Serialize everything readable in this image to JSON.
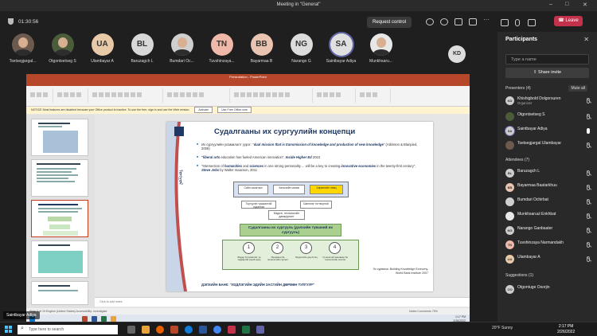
{
  "window": {
    "title": "Meeting in \"General\""
  },
  "header": {
    "timer": "01:30:56",
    "request_control": "Request control",
    "leave": "Leave"
  },
  "strip": {
    "participants": [
      {
        "initials": "",
        "name": "Tsetsegjargal...",
        "photo": true
      },
      {
        "initials": "",
        "name": "Otgontsetseg S",
        "photo": true
      },
      {
        "initials": "UA",
        "name": "Ulambayar A",
        "color": "#e8c9a8"
      },
      {
        "initials": "BL",
        "name": "Baruzagch L",
        "color": "#d8d8d8"
      },
      {
        "initials": "",
        "name": "Bumdari Oc...",
        "photo": true
      },
      {
        "initials": "TN",
        "name": "Tuvshinzaya...",
        "color": "#f0b8a8"
      },
      {
        "initials": "BB",
        "name": "Bayarmaa B",
        "color": "#e9c4b0"
      },
      {
        "initials": "NG",
        "name": "Narango G",
        "color": "#dcdcdc"
      },
      {
        "initials": "SA",
        "name": "Saintbayar Adiya",
        "color": "#e0e0e0"
      },
      {
        "initials": "",
        "name": "Munkhsaru...",
        "photo": true
      }
    ],
    "extra": "KD"
  },
  "ppt": {
    "title": "Presentation - PowerPoint",
    "tabs": [
      "File",
      "Home",
      "Insert",
      "Design",
      "Transitions",
      "Animations",
      "Slide Show",
      "Review",
      "View",
      "Help"
    ],
    "notice": "NOTICE  Most features are disabled because your Office product is inactive. To use the free, sign in and use the Web version.",
    "notice_btn1": "Activate",
    "notice_btn2": "Use Free Office.com",
    "notes_placeholder": "Click to add notes",
    "status_left": "Slide 3 of 19     English (United States)     Accessibility: Investigate",
    "status_right": "Notes     Comments     75%",
    "inner_time": "1:17 PM",
    "inner_date": "2/26/2022",
    "thumb_numbers": [
      "1",
      "2",
      "3",
      "4",
      "5"
    ]
  },
  "slide": {
    "title": "Судалгааны их сургуулийн концепци",
    "b1_a": "Их сургуулийн уламжлалт үүрэг: \"",
    "b1_em": "dual mission that is transmission of knowledge and production of new knowledge",
    "b1_b": "\" (Atkinson & Blanpied, 2008)",
    "b2_em": "\"liberal arts",
    "b2_b": " education has fueled American innovation\", ",
    "b2_c": "Inside Higher Ed",
    "b2_d": " 2010",
    "b3_a": "\"Intersection of ",
    "b3_em1": "humanities",
    "b3_b": " and ",
    "b3_em2": "sciences",
    "b3_c": " in one strong personality ... will be a key to creating ",
    "b3_em3": "innovative economies",
    "b3_d": " in the twenty-first century\", ",
    "b3_e": "Steve Jobs",
    "b3_f": " by Walter Isaacson, 2011",
    "box1": "Сайн засаглал",
    "box2": "Хөгжлийн чөлөө",
    "box3": "Хөрөнгийн нөөц",
    "box4": "Торгуулін тушаалтай судалгаа",
    "box5": "Шинэлэг тогтвортой",
    "box6": "Мэдлэг, технологийн дамжуулалт",
    "box7": "Судалгааны их сургууль (дэлхийн түвшний их сургууль)",
    "circles": [
      "1",
      "2",
      "3",
      "4"
    ],
    "caps": [
      "Өндөр бүтээмжтэй, үр чадвартай хүний нөөц",
      "Инноваци ба технологийн сургалт",
      "Мэдлэгийн дэд бүтэц",
      "Үр ашигтай инноваци ба технологийн систем"
    ],
    "source": "Эх сурвалж: Building Knowledge Economy, World Bank Institute 2007",
    "footer": "ДЭЛХИЙН БАНК: \"ИЗДЛЭГИЙН ЭДИЙН ЗАСГИЙН ДӨРВӨН ТУЛГУУР\""
  },
  "presenter": "Saintbayar Adiya",
  "panel": {
    "title": "Participants",
    "search_placeholder": "Type a name",
    "share_invite": "Share invite",
    "presenters_label": "Presenters (4)",
    "mute_all": "Mute all",
    "presenters": [
      {
        "initials": "KD",
        "name": "Khishigbold Dolgorsuren",
        "role": "Organizer",
        "mic": "off"
      },
      {
        "initials": "",
        "name": "Otgontsetseg S",
        "role": "",
        "mic": "off"
      },
      {
        "initials": "SA",
        "name": "Saintbayar Adiya",
        "role": "",
        "mic": "on"
      },
      {
        "initials": "",
        "name": "Tsetsegjargal Ulambayar",
        "role": "",
        "mic": "off"
      }
    ],
    "attendees_label": "Attendees (7)",
    "attendees": [
      {
        "initials": "BL",
        "name": "Baruzagch L"
      },
      {
        "initials": "BB",
        "name": "Bayarmaa Baatarkhuu"
      },
      {
        "initials": "",
        "name": "Bumdari Ochirbat"
      },
      {
        "initials": "",
        "name": "Munkhsaruul Enkhbat"
      },
      {
        "initials": "NG",
        "name": "Narango Ganbaater"
      },
      {
        "initials": "TN",
        "name": "Tuvshinzaya Narmandakh"
      },
      {
        "initials": "UA",
        "name": "Ulambayar A"
      }
    ],
    "suggestions_label": "Suggestions (1)",
    "suggestions": [
      {
        "initials": "OO",
        "name": "Otgontuge Osorjin"
      }
    ]
  },
  "taskbar": {
    "search_placeholder": "Type here to search",
    "weather": "20°F  Sunny",
    "time": "2:17 PM",
    "date": "2/26/2022"
  },
  "colors": {
    "accent_red": "#c4314b",
    "ppt_red": "#b7472a",
    "teams_purple": "#6264a7"
  }
}
